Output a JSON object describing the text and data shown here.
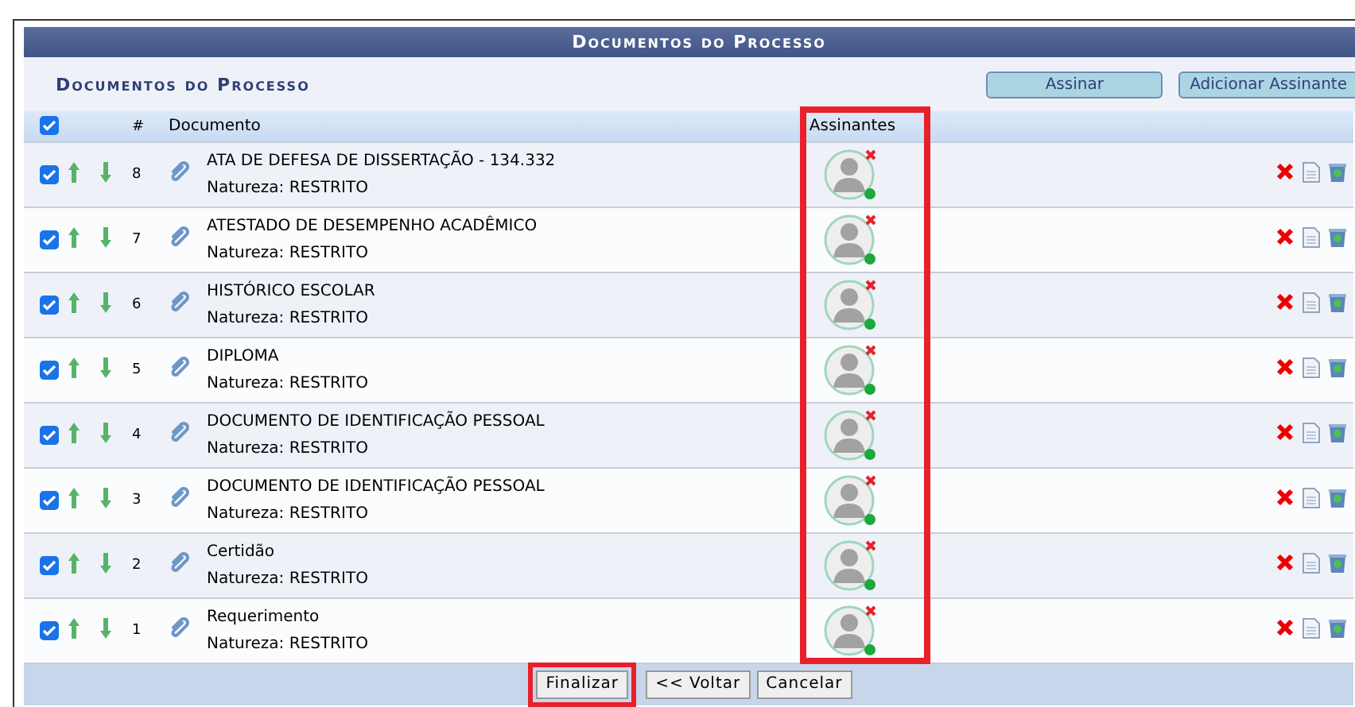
{
  "panel": {
    "title": "Documentos do Processo",
    "subtitle": "Documentos do Processo",
    "buttons": [
      "Assinar",
      "Adicionar Assinante"
    ]
  },
  "table": {
    "select_all": {
      "checked": true
    },
    "columns": [
      "#",
      "Documento",
      "Assinantes"
    ],
    "rows": [
      {
        "checked": true,
        "number": "8",
        "title": "ATA DE DEFESA DE DISSERTAÇÃO - 134.332",
        "nature": "Natureza: RESTRITO"
      },
      {
        "checked": true,
        "number": "7",
        "title": "ATESTADO DE DESEMPENHO ACADÊMICO",
        "nature": "Natureza: RESTRITO"
      },
      {
        "checked": true,
        "number": "6",
        "title": "HISTÓRICO ESCOLAR",
        "nature": "Natureza: RESTRITO"
      },
      {
        "checked": true,
        "number": "5",
        "title": "DIPLOMA",
        "nature": "Natureza: RESTRITO"
      },
      {
        "checked": true,
        "number": "4",
        "title": "DOCUMENTO DE IDENTIFICAÇÃO PESSOAL",
        "nature": "Natureza: RESTRITO"
      },
      {
        "checked": true,
        "number": "3",
        "title": "DOCUMENTO DE IDENTIFICAÇÃO PESSOAL",
        "nature": "Natureza: RESTRITO"
      },
      {
        "checked": true,
        "number": "2",
        "title": "Certidão",
        "nature": "Natureza: RESTRITO"
      },
      {
        "checked": true,
        "number": "1",
        "title": "Requerimento",
        "nature": "Natureza: RESTRITO"
      }
    ]
  },
  "footer": {
    "buttons": [
      {
        "label": "Finalizar",
        "highlighted": true
      },
      {
        "label": "<< Voltar",
        "highlighted": false
      },
      {
        "label": "Cancelar",
        "highlighted": false
      }
    ]
  }
}
